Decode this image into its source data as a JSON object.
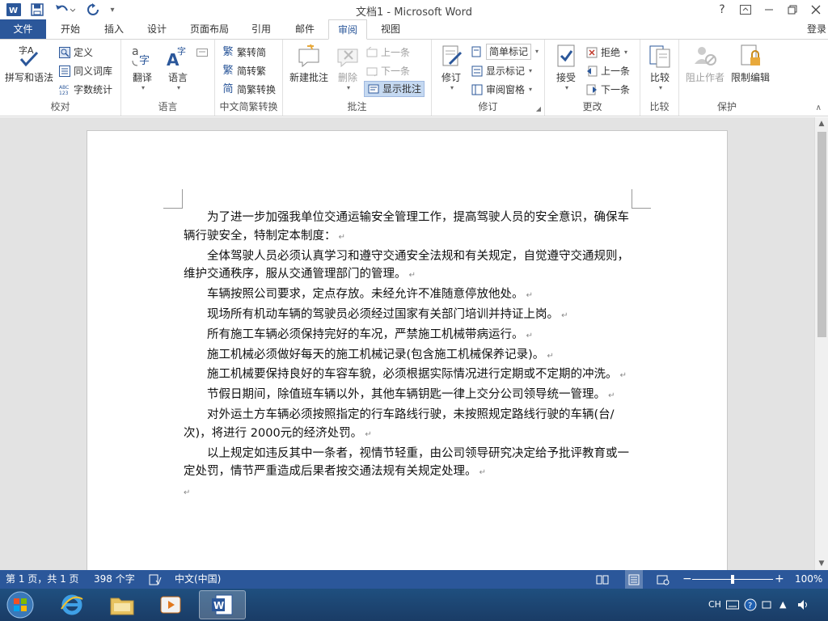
{
  "window": {
    "title": "文档1 - Microsoft Word",
    "help": "?",
    "login": "登录"
  },
  "tabs": [
    "文件",
    "开始",
    "插入",
    "设计",
    "页面布局",
    "引用",
    "邮件",
    "审阅",
    "视图"
  ],
  "active_tab": "审阅",
  "ribbon": {
    "proofing": {
      "label": "校对",
      "spelling": "拼写和语法",
      "define": "定义",
      "thesaurus": "同义词库",
      "word_count": "字数统计"
    },
    "language": {
      "label": "语言",
      "translate": "翻译",
      "language": "语言"
    },
    "chinese": {
      "label": "中文简繁转换",
      "to_simplified": "繁转简",
      "to_traditional": "简转繁",
      "convert": "简繁转换"
    },
    "comments": {
      "label": "批注",
      "new": "新建批注",
      "delete": "删除",
      "previous": "上一条",
      "next": "下一条",
      "show": "显示批注"
    },
    "tracking": {
      "label": "修订",
      "track": "修订",
      "markup_mode": "简单标记",
      "show_markup": "显示标记",
      "reviewing_pane": "审阅窗格"
    },
    "changes": {
      "label": "更改",
      "accept": "接受",
      "reject": "拒绝",
      "previous": "上一条",
      "next": "下一条"
    },
    "compare": {
      "label": "比较",
      "compare": "比较"
    },
    "protect": {
      "label": "保护",
      "block_authors": "阻止作者",
      "restrict": "限制编辑"
    }
  },
  "document": {
    "paragraphs": [
      "为了进一步加强我单位交通运输安全管理工作，提高驾驶人员的安全意识，确保车辆行驶安全，特制定本制度：",
      "全体驾驶人员必须认真学习和遵守交通安全法规和有关规定，自觉遵守交通规则，维护交通秩序，服从交通管理部门的管理。",
      "车辆按照公司要求，定点存放。未经允许不准随意停放他处。",
      "现场所有机动车辆的驾驶员必须经过国家有关部门培训并持证上岗。",
      "所有施工车辆必须保持完好的车况，严禁施工机械带病运行。",
      "施工机械必须做好每天的施工机械记录(包含施工机械保养记录)。",
      "施工机械要保持良好的车容车貌，必须根据实际情况进行定期或不定期的冲洗。",
      "节假日期间，除值班车辆以外，其他车辆钥匙一律上交分公司领导统一管理。",
      "对外运土方车辆必须按照指定的行车路线行驶，未按照规定路线行驶的车辆(台/次)，将进行 2000元的经济处罚。",
      "以上规定如违反其中一条者，视情节轻重，由公司领导研究决定给予批评教育或一定处罚，情节严重造成后果者按交通法规有关规定处理。"
    ]
  },
  "status": {
    "page": "第 1 页，共 1 页",
    "words": "398 个字",
    "language": "中文(中国)",
    "zoom": "100%",
    "zoom_level": 1.0
  },
  "tray": {
    "ime": "CH"
  },
  "colors": {
    "accent": "#2b579a",
    "statusbar": "#2b579a"
  }
}
